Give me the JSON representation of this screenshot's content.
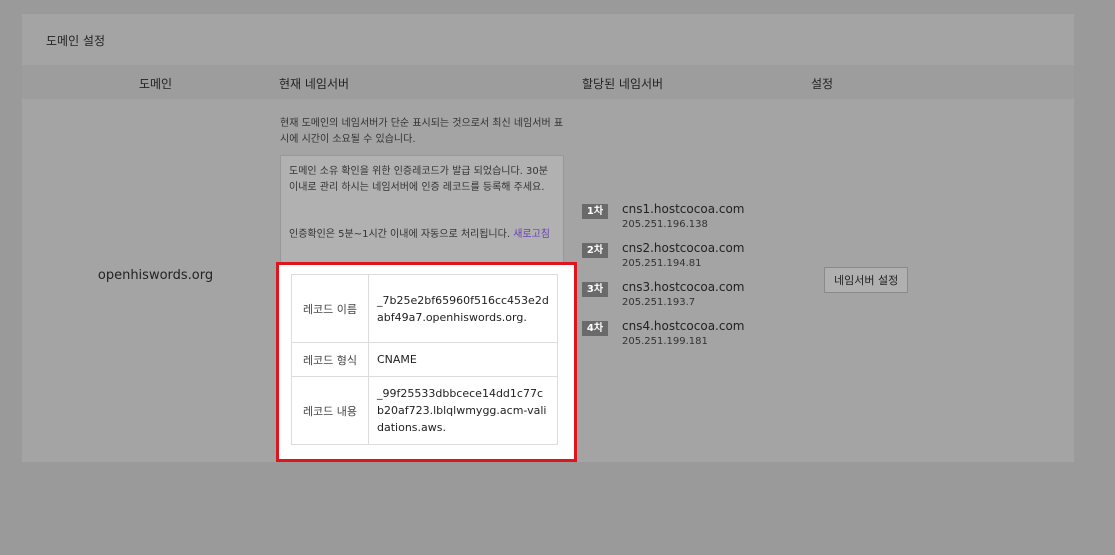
{
  "panel": {
    "title": "도메인 설정"
  },
  "table": {
    "headers": {
      "domain": "도메인",
      "current_ns": "현재 네임서버",
      "assigned_ns": "할당된 네임서버",
      "settings": "설정"
    },
    "row": {
      "domain": "openhiswords.org",
      "current_note": "현재 도메인의 네임서버가 단순 표시되는 것으로서 최신 네임서버 표시에 시간이 소요될 수 있습니다.",
      "cert_message": "도메인 소유 확인을 위한 인증레코드가 발급 되었습니다. 30분 이내로 관리 하시는 네임서버에 인증 레코드를 등록해 주세요.",
      "cert_auto": "인증확인은 5분~1시간 이내에 자동으로 처리됩니다.",
      "refresh_link": "새로고침",
      "records": [
        {
          "label": "레코드 이름",
          "value": "_7b25e2bf65960f516cc453e2dabf49a7.openhiswords.org."
        },
        {
          "label": "레코드 형식",
          "value": "CNAME"
        },
        {
          "label": "레코드 내용",
          "value": "_99f25533dbbcece14dd1c77cb20af723.lblqlwmygg.acm-validations.aws."
        }
      ],
      "nameservers": [
        {
          "badge": "1차",
          "host": "cns1.hostcocoa.com",
          "ip": "205.251.196.138"
        },
        {
          "badge": "2차",
          "host": "cns2.hostcocoa.com",
          "ip": "205.251.194.81"
        },
        {
          "badge": "3차",
          "host": "cns3.hostcocoa.com",
          "ip": "205.251.193.7"
        },
        {
          "badge": "4차",
          "host": "cns4.hostcocoa.com",
          "ip": "205.251.199.181"
        }
      ],
      "settings_button": "네임서버 설정"
    }
  },
  "colors": {
    "highlight_border": "#e0141c",
    "link": "#6a3fb4",
    "badge_bg": "#6a6a6a"
  }
}
